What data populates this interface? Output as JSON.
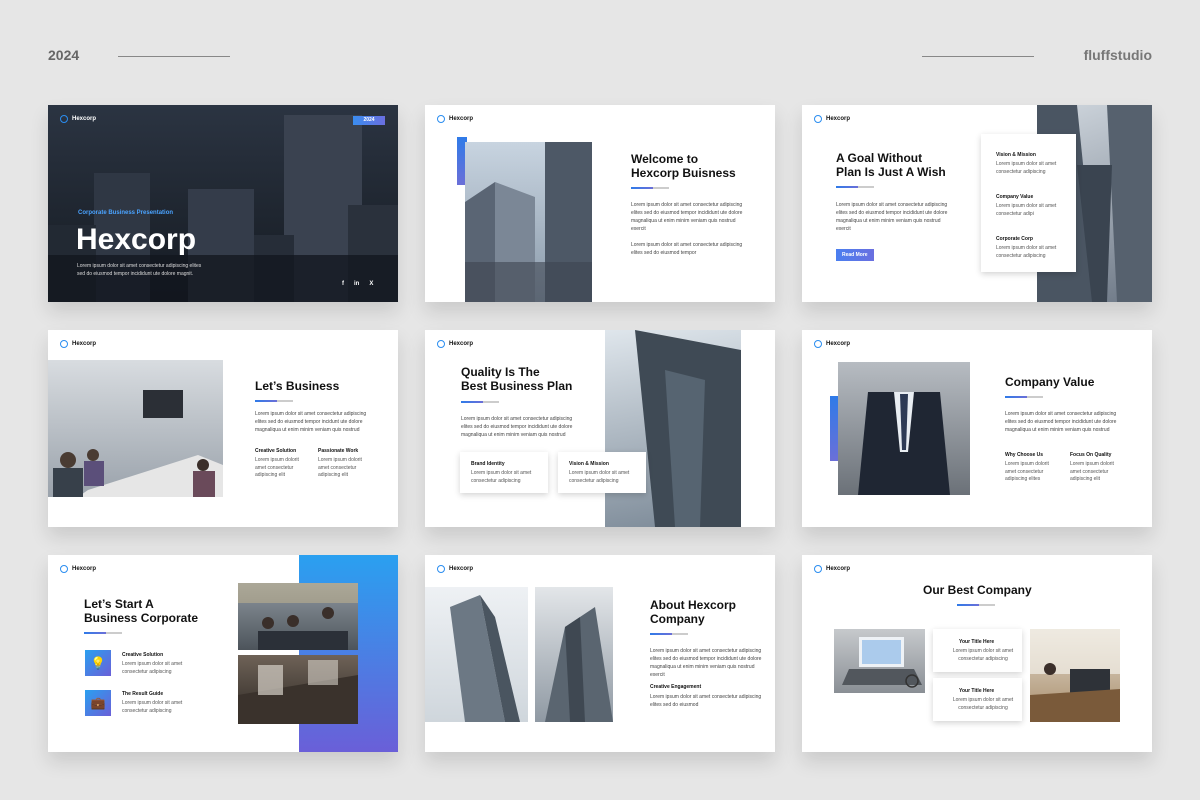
{
  "header": {
    "year": "2024",
    "brand": "fluffstudio"
  },
  "logo_text": "Hexcorp",
  "lorem_long": "Lorem ipsum dolor sit amet consectetur adipiscing elites sed do eiusmod tempor incidunt ute dolore magnaliqua ut enim minim veniam quis nostrud exercit",
  "lorem_short": "Lorem ipsum dolor sit amet consectetur adipiscing elit",
  "slide1": {
    "year_badge": "2024",
    "subtitle": "Corporate Business Presentation",
    "title": "Hexcorp",
    "body": "Lorem ipsum dolor sit amet consectetur adipiscing elites sed do eiusmod tempor incididunt ute dolore magnit.",
    "social": [
      "f",
      "in",
      "X"
    ]
  },
  "slide2": {
    "title_line1": "Welcome to",
    "title_line2": "Hexcorp Buisness",
    "para1": "Lorem ipsum dolor sit amet consectetur adipiscing elites sed do eiusmod tempor incididunt ute dolore magnaliqua ut enim minim veniam quis nostrud exercit",
    "para2": "Lorem ipsum dolor sit amet consectetur adipiscing elites sed do eiusmod tempor"
  },
  "slide3": {
    "title_line1": "A Goal Without",
    "title_line2": "Plan Is Just A Wish",
    "body": "Lorem ipsum dolor sit amet consectetur adipiscing elites sed do eiusmod tempor incididunt ute dolore magnaliqua ut enim minim veniam quis nostrud exercit",
    "button": "Read More",
    "items": [
      {
        "title": "Vision & Mission",
        "text": "Lorem ipsum dolor sit amet consectetur adipiscing"
      },
      {
        "title": "Company Value",
        "text": "Lorem ipsum dolor sit amet consectetur adipi"
      },
      {
        "title": "Corporate Corp",
        "text": "Lorem ipsum dolor sit amet consectetur adipiscing"
      }
    ]
  },
  "slide4": {
    "title": "Let’s Business",
    "body": "Lorem ipsum dolor sit amet consectetur adipiscing elites sed do eiusmod tempor incidunt ute dolore magnaliqua ut enim minim veniam quis nostrud",
    "col1_title": "Creative Solution",
    "col1_text": "Lorem ipsum dolorit amet consectetur adipiscing elit",
    "col2_title": "Passionate Work",
    "col2_text": "Lorem ipsum dolorit amet consectetur adipiscing elit"
  },
  "slide5": {
    "title_line1": "Quality Is The",
    "title_line2": "Best Business Plan",
    "body": "Lorem ipsum dolor sit amet consectetur adipiscing elites sed do eiusmod tempor incididunt ute dolore magnaliqua ut enim minim veniam quis nostrud",
    "card1_title": "Brand Identity",
    "card1_text": "Lorem ipsum dolor sit amet consectetur adipiscing",
    "card2_title": "Vision & Mission",
    "card2_text": "Lorem ipsum dolor sit amet consectetur adipiscing"
  },
  "slide6": {
    "title": "Company Value",
    "body": "Lorem ipsum dolor sit amet consectetur adipiscing elites sed do eiusmod tempor incididunt ute dolore magnaliqua ut enim minim veniam quis nostrud",
    "col1_title": "Why Choose Us",
    "col1_text": "Lorem ipsum dolorit amet consectetur adipiscing elites",
    "col2_title": "Focus On Quality",
    "col2_text": "Lorem ipsum dolorit amet consectetur adipiscing elit"
  },
  "slide7": {
    "title_line1": "Let’s Start A",
    "title_line2": "Business Corporate",
    "item1_title": "Creative Solution",
    "item1_text": "Lorem ipsum dolor sit amet consectetur adipiscing",
    "item2_title": "The Result Guide",
    "item2_text": "Lorem ipsum dolor sit amet consectetur adipiscing"
  },
  "slide8": {
    "title_line1": "About Hexcorp",
    "title_line2": "Company",
    "body": "Lorem ipsum dolor sit amet consectetur adipiscing elites sed do eiusmod tempor incididunt ute dolore magnaliqua ut enim minim veniam quis nostrud exercit",
    "sub_title": "Creative Engagement",
    "sub_text": "Lorem ipsum dolor sit amet consectetur adipiscing elites sed do eiusmod"
  },
  "slide9": {
    "title": "Our Best Company",
    "card1_title": "Your Title Here",
    "card1_text": "Lorem ipsum dolor sit amet consectetur adipiscing",
    "card2_title": "Your Title Here",
    "card2_text": "Lorem ipsum dolor sit amet consectetur adipiscing"
  }
}
